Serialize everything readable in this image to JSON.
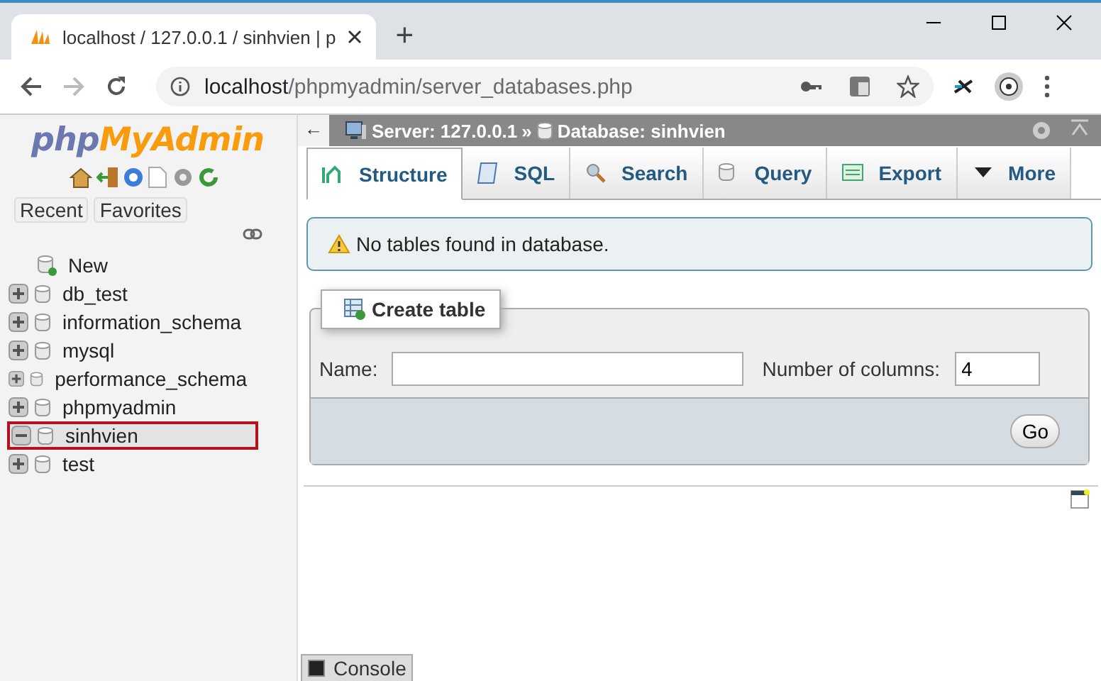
{
  "browser": {
    "tab_title": "localhost / 127.0.0.1 / sinhvien | p",
    "new_tab": "+",
    "url_host": "localhost",
    "url_path": "/phpmyadmin/server_databases.php"
  },
  "sidebar": {
    "logo": [
      "php",
      "MyAdmin"
    ],
    "buttons": [
      "Recent",
      "Favorites"
    ],
    "tree": [
      {
        "label": "New",
        "kind": "new"
      },
      {
        "label": "db_test",
        "kind": "db",
        "expanded": false,
        "selected": false
      },
      {
        "label": "information_schema",
        "kind": "db",
        "expanded": false,
        "selected": false
      },
      {
        "label": "mysql",
        "kind": "db",
        "expanded": false,
        "selected": false
      },
      {
        "label": "performance_schema",
        "kind": "db",
        "expanded": false,
        "selected": false
      },
      {
        "label": "phpmyadmin",
        "kind": "db",
        "expanded": false,
        "selected": false
      },
      {
        "label": "sinhvien",
        "kind": "db",
        "expanded": true,
        "selected": true
      },
      {
        "label": "test",
        "kind": "db",
        "expanded": false,
        "selected": false
      }
    ]
  },
  "breadcrumb": {
    "back": "←",
    "server": "Server: 127.0.0.1",
    "separator": "»",
    "database": "Database: sinhvien"
  },
  "tabs": [
    {
      "label": "Structure",
      "selected": true
    },
    {
      "label": "SQL",
      "selected": false
    },
    {
      "label": "Search",
      "selected": false
    },
    {
      "label": "Query",
      "selected": false
    },
    {
      "label": "Export",
      "selected": false
    },
    {
      "label": "More",
      "selected": false
    }
  ],
  "notice": "No tables found in database.",
  "create_table": {
    "legend": "Create table",
    "name_label": "Name:",
    "columns_label": "Number of columns:",
    "columns_value": "4",
    "go": "Go"
  },
  "console": "Console"
}
